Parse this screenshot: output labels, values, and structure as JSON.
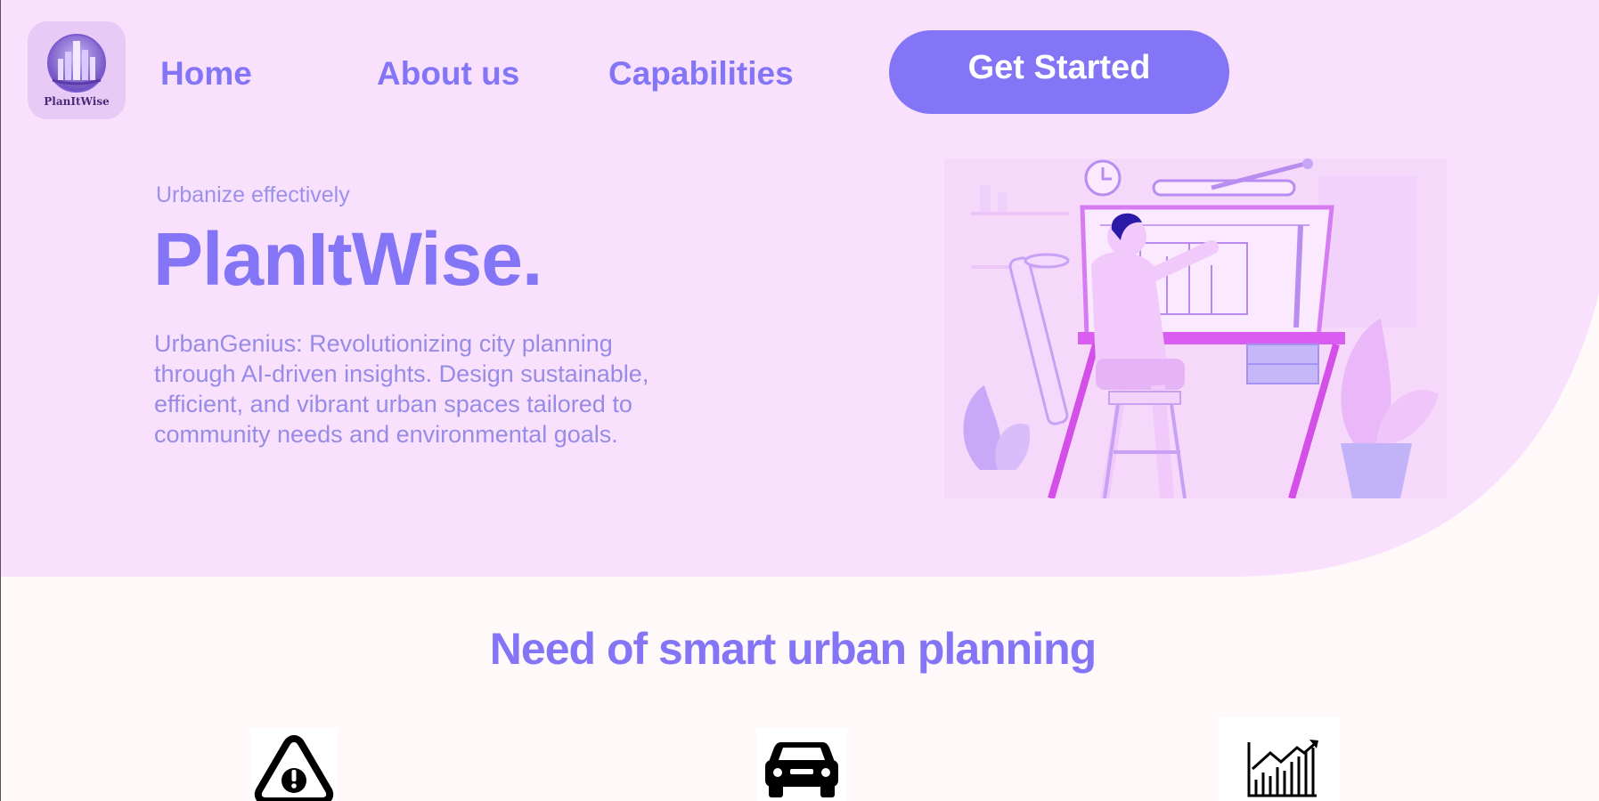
{
  "brand": {
    "logo_text": "PlanItWise",
    "logo_icon": "city-globe-icon"
  },
  "nav": {
    "home": "Home",
    "about": "About us",
    "capabilities": "Capabilities",
    "cta": "Get Started"
  },
  "hero": {
    "eyebrow": "Urbanize effectively",
    "title": "PlanItWise.",
    "description": "UrbanGenius: Revolutionizing city planning through AI-driven insights. Design sustainable, efficient, and vibrant urban spaces tailored to community needs and environmental goals.",
    "illustration": "architect-at-drafting-table-illustration"
  },
  "section": {
    "title": "Need of smart urban planning",
    "features": [
      {
        "icon": "warning-icon"
      },
      {
        "icon": "car-icon"
      },
      {
        "icon": "growth-chart-icon"
      }
    ]
  },
  "colors": {
    "accent": "#8375f6",
    "hero_bg": "#f9e1fd",
    "page_bg": "#fffaf9",
    "muted_text": "#968ce6"
  }
}
